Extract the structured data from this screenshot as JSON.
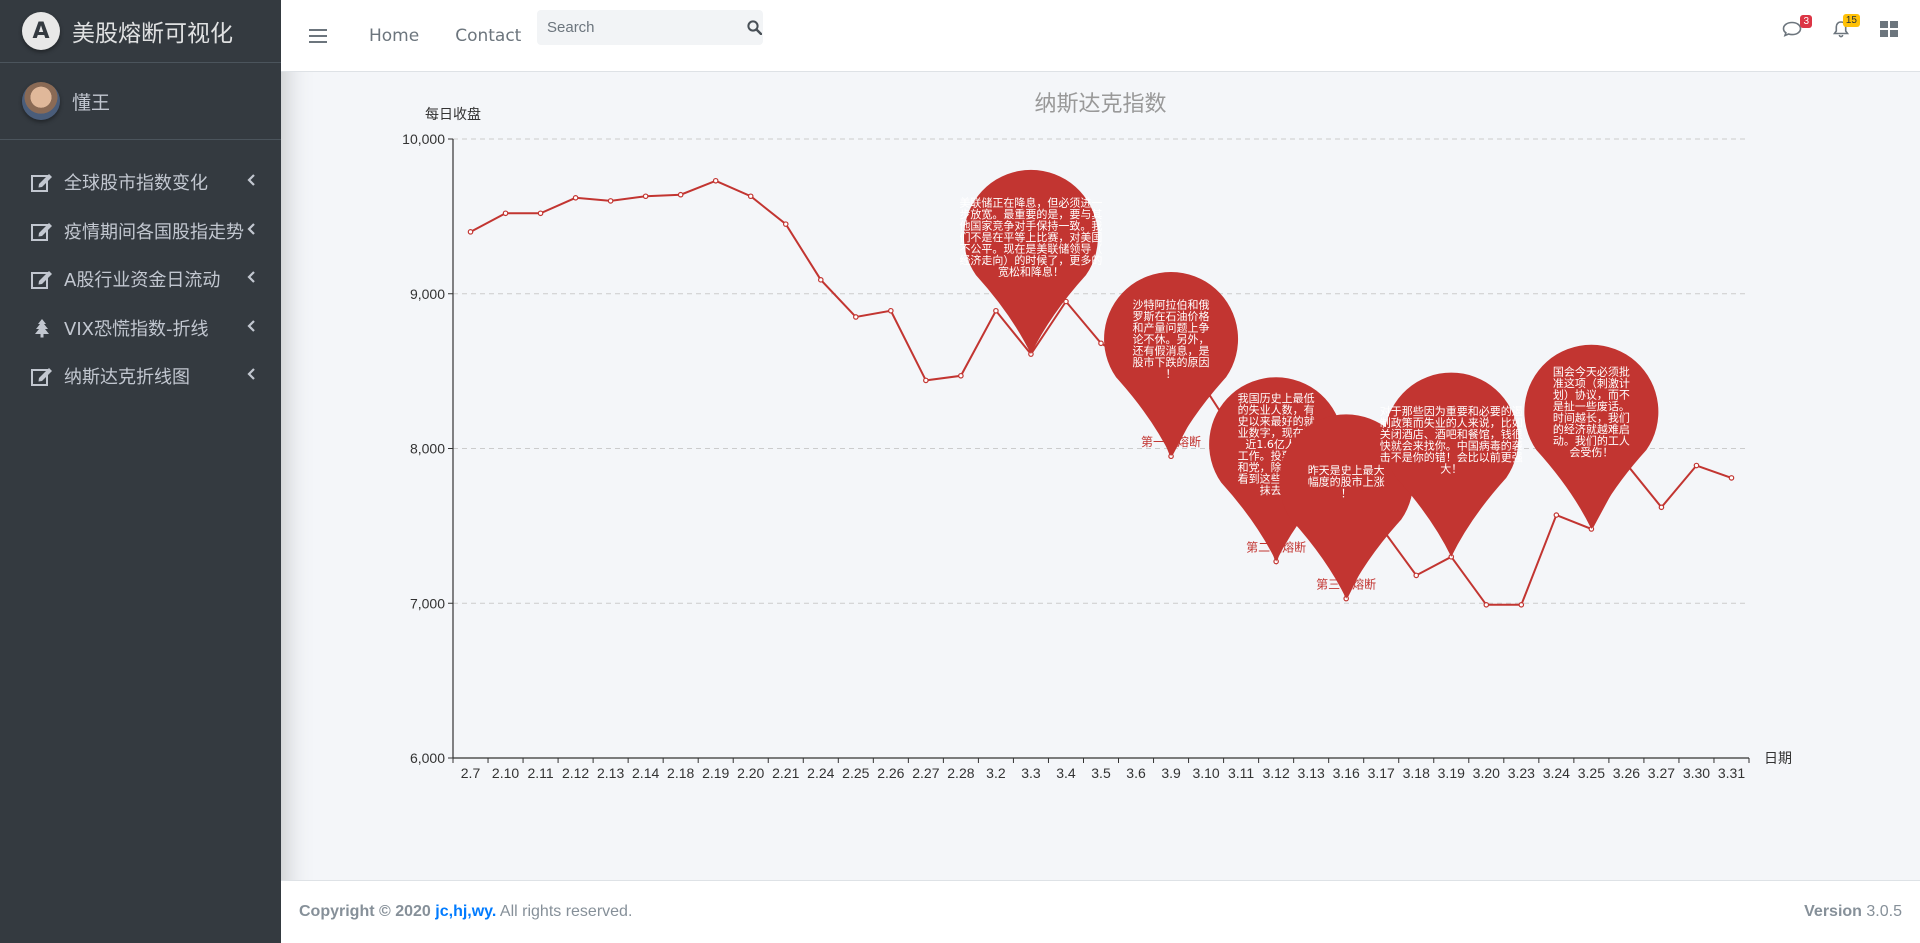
{
  "brand": {
    "title": "美股熔断可视化",
    "logo_letter": "A"
  },
  "user": {
    "name": "懂王"
  },
  "sidebar": {
    "items": [
      {
        "label": "全球股市指数变化",
        "icon": "edit-icon"
      },
      {
        "label": "疫情期间各国股指走势",
        "icon": "edit-icon"
      },
      {
        "label": "A股行业资金日流动",
        "icon": "edit-icon"
      },
      {
        "label": "VIX恐慌指数-折线",
        "icon": "tree-icon"
      },
      {
        "label": "纳斯达克折线图",
        "icon": "edit-icon"
      }
    ]
  },
  "navbar": {
    "links": [
      "Home",
      "Contact"
    ],
    "search_placeholder": "Search",
    "messages_count": "3",
    "notifications_count": "15"
  },
  "footer": {
    "copyright_prefix": "Copyright © 2020",
    "copyright_link": "jc,hj,wy.",
    "copyright_suffix": "All rights reserved.",
    "version_label": "Version",
    "version_value": "3.0.5"
  },
  "colors": {
    "line": "#c23531",
    "sidebar_bg": "#343a40",
    "accent": "#007bff"
  },
  "chart_data": {
    "type": "line",
    "title": "纳斯达克指数",
    "ylabel": "每日收盘",
    "xlabel": "日期",
    "ylim": [
      6000,
      10000
    ],
    "yticks": [
      "6,000",
      "7,000",
      "8,000",
      "9,000",
      "10,000"
    ],
    "grid": true,
    "x": [
      "2.7",
      "2.10",
      "2.11",
      "2.12",
      "2.13",
      "2.14",
      "2.18",
      "2.19",
      "2.20",
      "2.21",
      "2.24",
      "2.25",
      "2.26",
      "2.27",
      "2.28",
      "3.2",
      "3.3",
      "3.4",
      "3.5",
      "3.6",
      "3.9",
      "3.10",
      "3.11",
      "3.12",
      "3.13",
      "3.16",
      "3.17",
      "3.18",
      "3.19",
      "3.20",
      "3.23",
      "3.24",
      "3.25",
      "3.26",
      "3.27",
      "3.30",
      "3.31"
    ],
    "values": [
      9400,
      9520,
      9520,
      9620,
      9600,
      9630,
      9640,
      9730,
      9630,
      9450,
      9090,
      8850,
      8890,
      8440,
      8470,
      8890,
      8610,
      8950,
      8680,
      8540,
      7950,
      8380,
      8030,
      7270,
      8020,
      7030,
      7490,
      7180,
      7300,
      6990,
      6990,
      7570,
      7480,
      7900,
      7620,
      7890,
      7810
    ],
    "annotations": [
      {
        "x": "3.9",
        "text": "第一次熔断"
      },
      {
        "x": "3.12",
        "text": "第二次熔断"
      },
      {
        "x": "3.16",
        "text": "第三次熔断"
      }
    ],
    "pins": [
      {
        "x": "3.3",
        "text": "美联储正在降息，但必须进一步放宽。最重要的是，要与其他国家竞争对手保持一致。我们不是在平等上比赛，对美国不公平。现在是美联储领导（经济走向）的时候了，更多的宽松和降息！"
      },
      {
        "x": "3.9",
        "text": "沙特阿拉伯和俄罗斯在石油价格和产量问题上争论不休。另外，还有假消息，是股市下跌的原因！"
      },
      {
        "x": "3.12",
        "text": "我国历史上最低的失业人数，有史以来最好的就业数字，现在有近1.6亿人在工作。投票给共和党，除非你想看到这些数字被抹去！"
      },
      {
        "x": "3.16",
        "text": "昨天是史上最大幅度的股市上涨！"
      },
      {
        "x": "3.19",
        "text": "对于那些因为重要和必要的遏制政策而失业的人来说，比如关闭酒店、酒吧和餐馆，钱很快就会来找你。中国病毒的袭击不是你的错！会比以前更强大！"
      },
      {
        "x": "3.25",
        "text": "国会今天必须批准这项（刺激计划）协议，而不是扯一些废话。时间越长，我们的经济就越难启动。我们的工人会受伤！"
      }
    ]
  }
}
